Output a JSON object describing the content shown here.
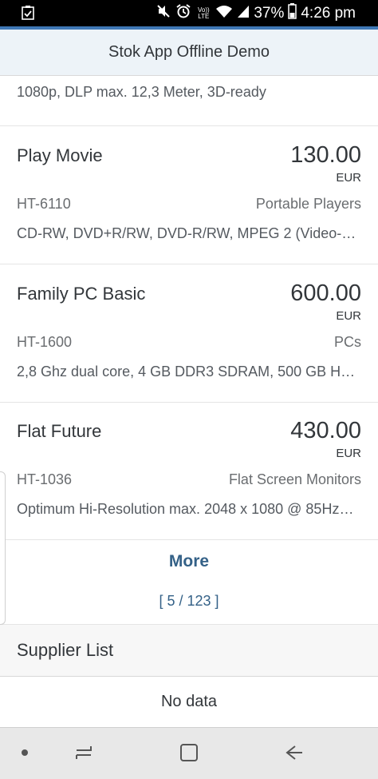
{
  "status_bar": {
    "volte_label": "Vo)) LTE",
    "battery_percent": "37%",
    "time": "4:26 pm",
    "icons": [
      "checklist-notification-icon",
      "mute-icon",
      "alarm-icon",
      "volte-icon",
      "wifi-icon",
      "signal-icon",
      "battery-icon"
    ]
  },
  "header": {
    "title": "Stok App Offline Demo"
  },
  "products": {
    "partial_description": "1080p, DLP max. 12,3 Meter, 3D-ready",
    "items": [
      {
        "name": "Play Movie",
        "price": "130.00",
        "currency": "EUR",
        "code": "HT-6110",
        "category": "Portable Players",
        "description": "CD-RW, DVD+R/RW, DVD-R/RW, MPEG 2 (Video-D…"
      },
      {
        "name": "Family PC Basic",
        "price": "600.00",
        "currency": "EUR",
        "code": "HT-1600",
        "category": "PCs",
        "description": "2,8 Ghz dual core, 4 GB DDR3 SDRAM, 500 GB H…"
      },
      {
        "name": "Flat Future",
        "price": "430.00",
        "currency": "EUR",
        "code": "HT-1036",
        "category": "Flat Screen Monitors",
        "description": "Optimum Hi-Resolution max. 2048 x 1080 @ 85Hz…"
      }
    ],
    "more_label": "More",
    "count_label": "[ 5 / 123 ]"
  },
  "supplier": {
    "title": "Supplier List",
    "empty_text": "No data"
  },
  "nav_bar": {
    "icons": [
      "dot-icon",
      "recent-apps-icon",
      "home-icon",
      "back-icon"
    ]
  },
  "colors": {
    "accent": "#3f78b6",
    "link": "#346187",
    "header_bg": "#edf3f8",
    "text": "#32363a"
  }
}
